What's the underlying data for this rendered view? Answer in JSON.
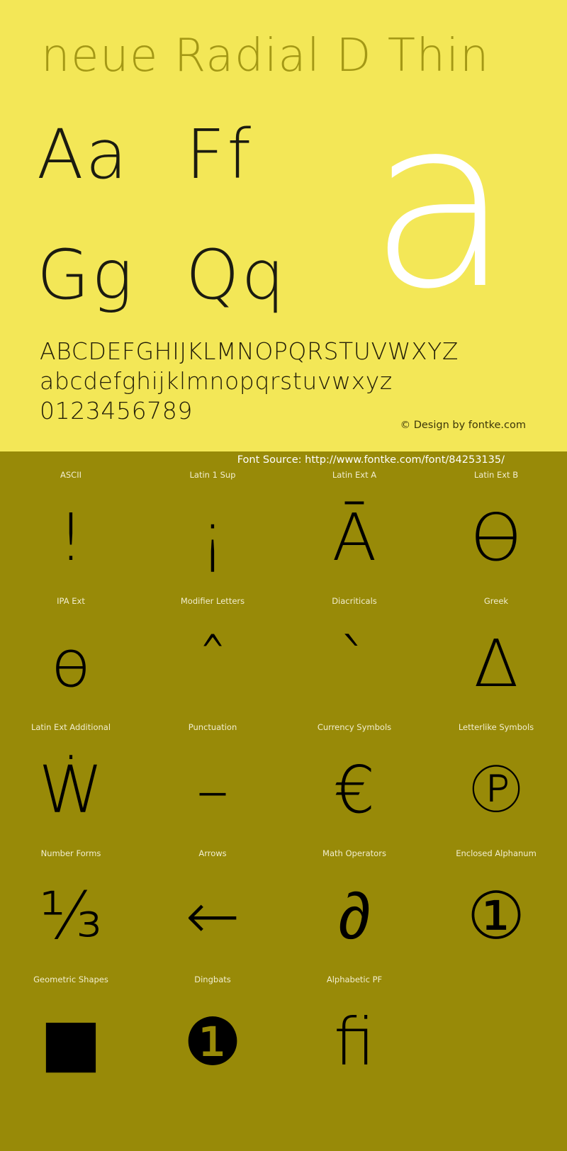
{
  "colors": {
    "panel_top_bg": "#F3E757",
    "panel_bottom_bg": "#988A08",
    "title_color": "#A09412",
    "glyph_color": "#1B1B10",
    "label_color": "#F2EECF",
    "big_letter_color": "#FFFFFF"
  },
  "specimen": {
    "title": "neue Radial D Thin",
    "big_letter": "a",
    "letter_pairs": [
      [
        "Aa",
        "Ff"
      ],
      [
        "Gg",
        "Qq"
      ]
    ],
    "uppercase": "ABCDEFGHIJKLMNOPQRSTUVWXYZ",
    "lowercase": "abcdefghijklmnopqrstuvwxyz",
    "digits": "0123456789",
    "copyright": "© Design by fontke.com"
  },
  "source": {
    "font_source": "Font Source: http://www.fontke.com/font/84253135/"
  },
  "unicode_blocks": [
    {
      "label": "ASCII",
      "glyph": "!"
    },
    {
      "label": "Latin 1 Sup",
      "glyph": "¡"
    },
    {
      "label": "Latin Ext A",
      "glyph": "Ā"
    },
    {
      "label": "Latin Ext B",
      "glyph": "Ɵ"
    },
    {
      "label": "IPA Ext",
      "glyph": "ɵ"
    },
    {
      "label": "Modifier Letters",
      "glyph": "ˆ"
    },
    {
      "label": "Diacriticals",
      "glyph": "ˋ"
    },
    {
      "label": "Greek",
      "glyph": "Δ"
    },
    {
      "label": "Latin Ext Additional",
      "glyph": "Ẇ"
    },
    {
      "label": "Punctuation",
      "glyph": "–"
    },
    {
      "label": "Currency Symbols",
      "glyph": "€"
    },
    {
      "label": "Letterlike Symbols",
      "glyph": "℗"
    },
    {
      "label": "Number Forms",
      "glyph": "⅓"
    },
    {
      "label": "Arrows",
      "glyph": "←"
    },
    {
      "label": "Math Operators",
      "glyph": "∂"
    },
    {
      "label": "Enclosed Alphanum",
      "glyph": "①"
    },
    {
      "label": "Geometric Shapes",
      "glyph": "■"
    },
    {
      "label": "Dingbats",
      "glyph": "❶"
    },
    {
      "label": "Alphabetic PF",
      "glyph": "ﬁ"
    }
  ]
}
